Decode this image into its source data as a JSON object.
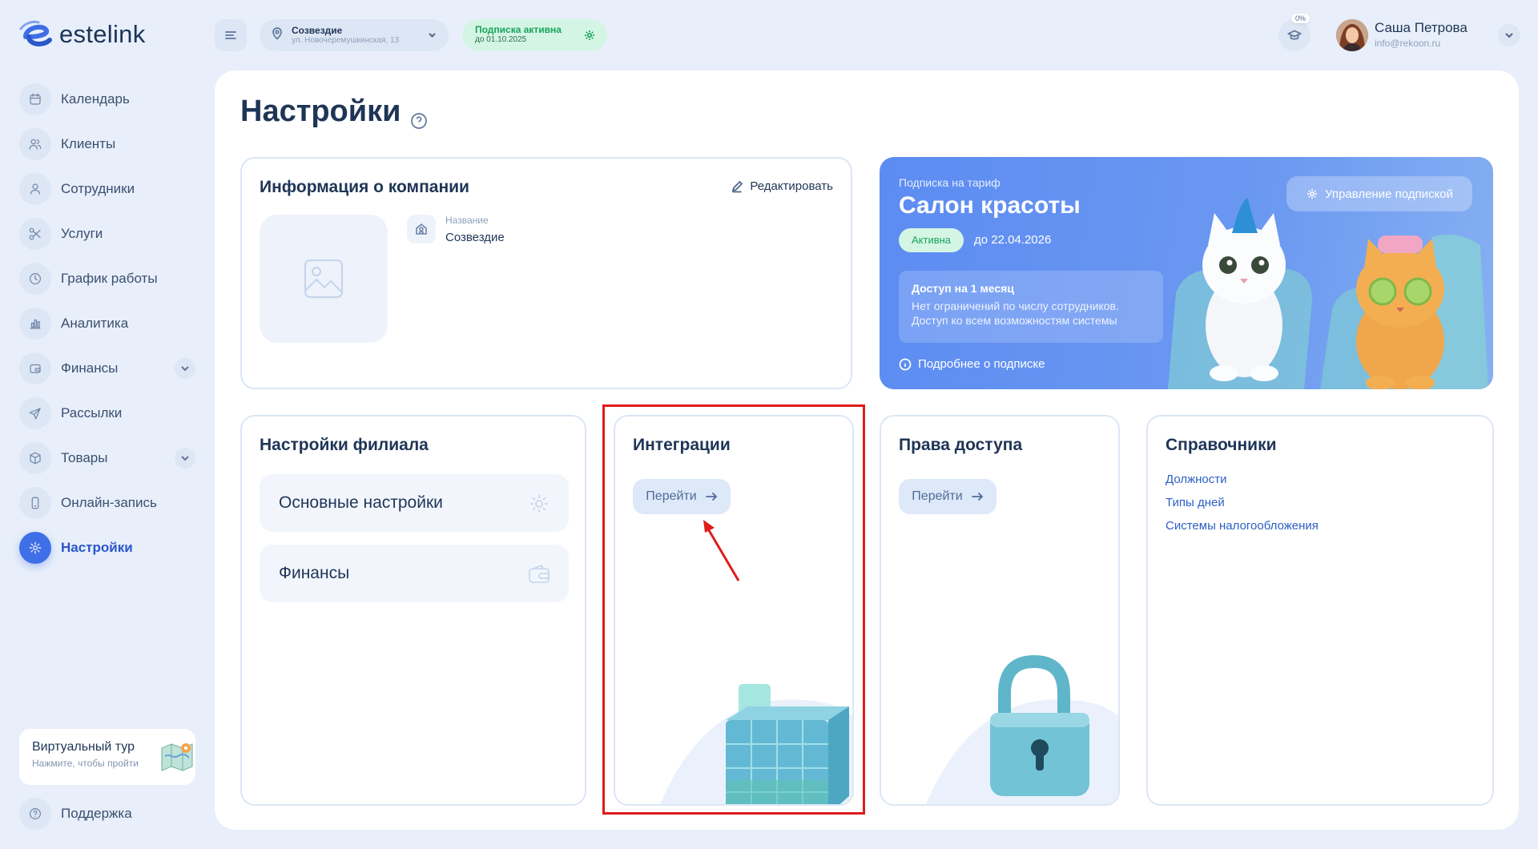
{
  "app": {
    "logo_text": "estelink"
  },
  "sidebar": {
    "items": [
      {
        "label": "Календарь",
        "icon": "calendar-icon"
      },
      {
        "label": "Клиенты",
        "icon": "clients-icon"
      },
      {
        "label": "Сотрудники",
        "icon": "employees-icon"
      },
      {
        "label": "Услуги",
        "icon": "scissors-icon"
      },
      {
        "label": "График работы",
        "icon": "clock-icon"
      },
      {
        "label": "Аналитика",
        "icon": "chart-icon"
      },
      {
        "label": "Финансы",
        "icon": "wallet-icon",
        "expandable": true
      },
      {
        "label": "Рассылки",
        "icon": "send-icon"
      },
      {
        "label": "Товары",
        "icon": "box-icon",
        "expandable": true
      },
      {
        "label": "Онлайн-запись",
        "icon": "phone-icon"
      },
      {
        "label": "Настройки",
        "icon": "gear-icon",
        "active": true
      }
    ],
    "tour": {
      "title": "Виртуальный тур",
      "subtitle": "Нажмите, чтобы пройти"
    },
    "support_label": "Поддержка"
  },
  "topbar": {
    "branch": {
      "name": "Созвездие",
      "address": "ул. Новочеремушкинская, 13"
    },
    "subscription_pill": {
      "title": "Подписка активна",
      "date": "до 01.10.2025"
    },
    "progress_badge": "0%",
    "user": {
      "name": "Саша Петрова",
      "email": "info@rekoon.ru"
    }
  },
  "page": {
    "title": "Настройки"
  },
  "company": {
    "title": "Информация о компании",
    "edit_label": "Редактировать",
    "field_label": "Название",
    "field_value": "Созвездие"
  },
  "subscription": {
    "caption": "Подписка на тариф",
    "plan": "Салон красоты",
    "status": "Активна",
    "until": "до 22.04.2026",
    "access_title": "Доступ на 1 месяц",
    "access_line1": "Нет ограничений по числу сотрудников.",
    "access_line2": "Доступ ко всем возможностям системы",
    "more_label": "Подробнее о подписке",
    "manage_label": "Управление подпиской"
  },
  "branch_settings": {
    "title": "Настройки филиала",
    "rows": [
      "Основные настройки",
      "Финансы"
    ]
  },
  "integrations": {
    "title": "Интеграции",
    "go_label": "Перейти"
  },
  "access_rights": {
    "title": "Права доступа",
    "go_label": "Перейти"
  },
  "references": {
    "title": "Справочники",
    "links": [
      "Должности",
      "Типы дней",
      "Системы налогообложения"
    ]
  },
  "colors": {
    "accent": "#3f6fe6",
    "success": "#17a45b",
    "annotation": "#e01b1b"
  }
}
